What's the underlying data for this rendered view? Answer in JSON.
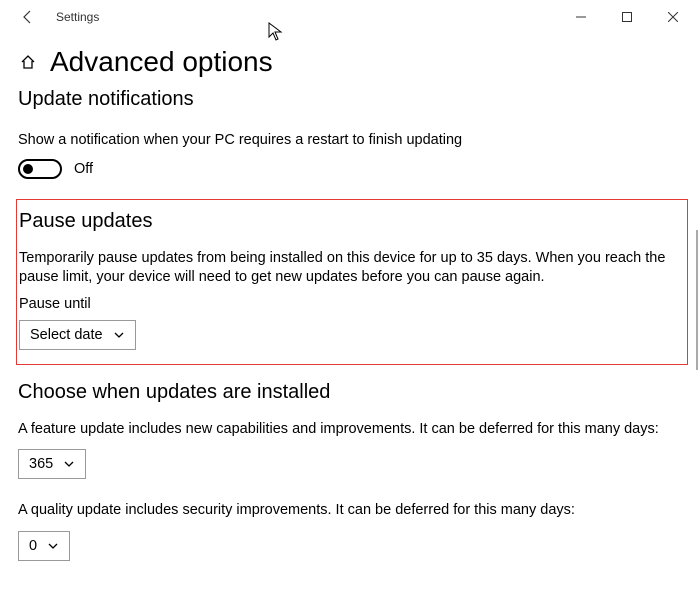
{
  "window": {
    "title": "Settings"
  },
  "page": {
    "title": "Advanced options"
  },
  "notifications": {
    "heading": "Update notifications",
    "desc": "Show a notification when your PC requires a restart to finish updating",
    "toggle_state": "Off"
  },
  "pause": {
    "heading": "Pause updates",
    "desc": "Temporarily pause updates from being installed on this device for up to 35 days. When you reach the pause limit, your device will need to get new updates before you can pause again.",
    "until_label": "Pause until",
    "select_label": "Select date"
  },
  "installed": {
    "heading": "Choose when updates are installed",
    "feature_desc": "A feature update includes new capabilities and improvements. It can be deferred for this many days:",
    "feature_value": "365",
    "quality_desc": "A quality update includes security improvements. It can be deferred for this many days:",
    "quality_value": "0"
  }
}
